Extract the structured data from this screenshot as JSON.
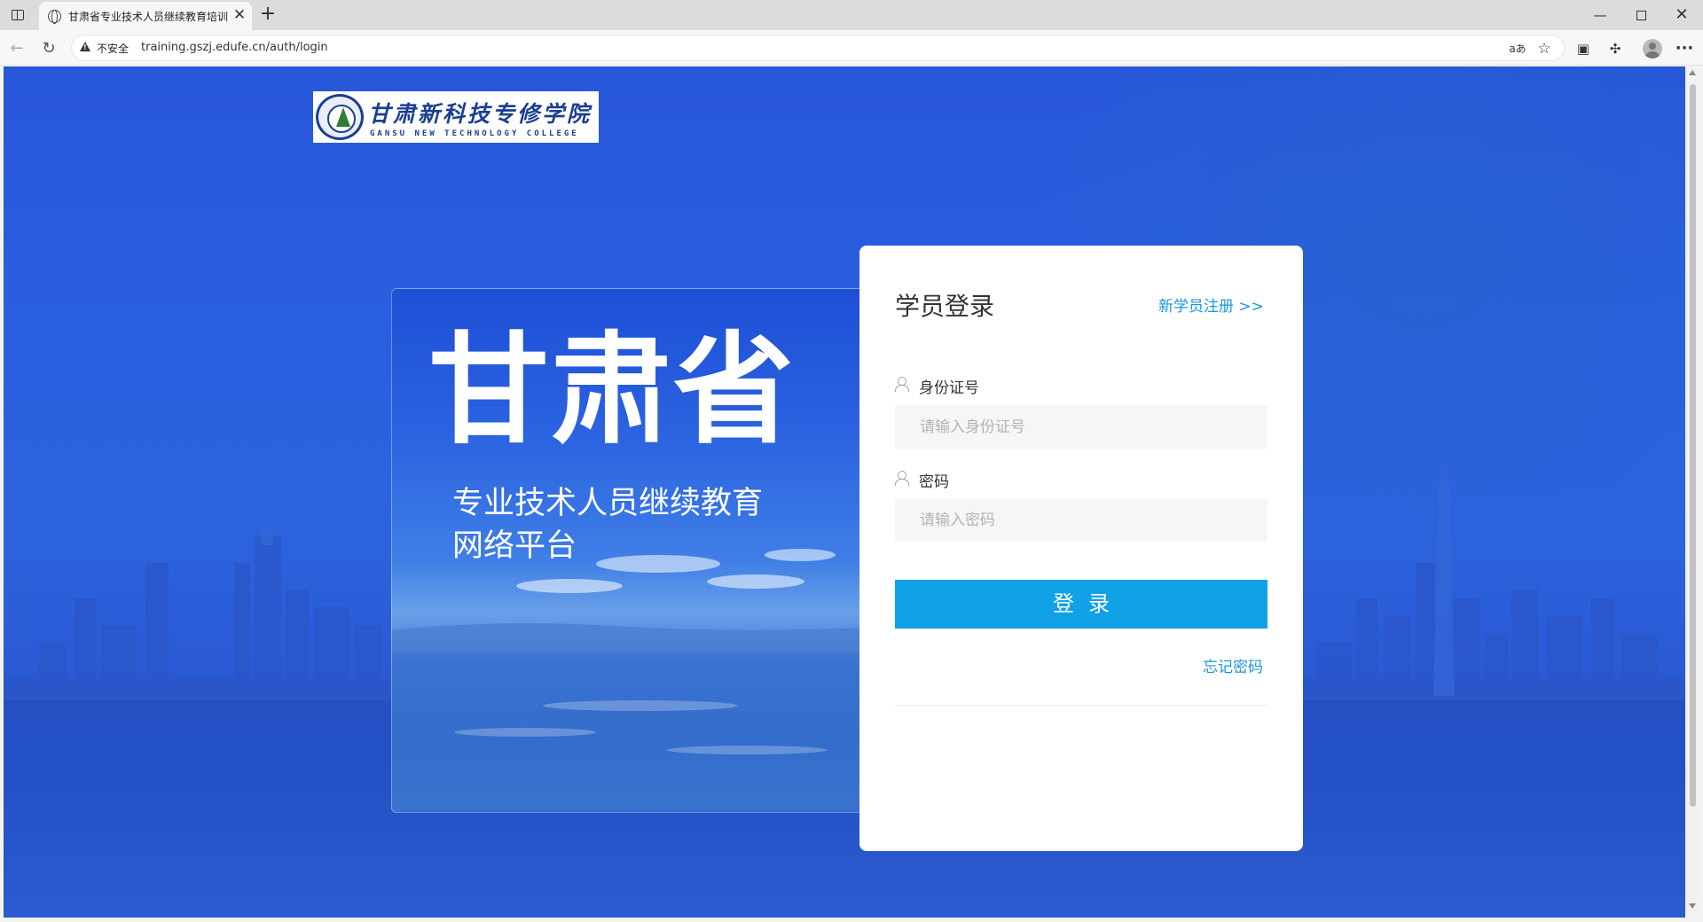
{
  "browser": {
    "tab_title": "甘肃省专业技术人员继续教育培训",
    "tab_close": "✕",
    "new_tab": "+",
    "insecure_label": "不安全",
    "url": "training.gszj.edufe.cn/auth/login",
    "translate_glyph": "aあ",
    "star_glyph": "☆",
    "more_glyph": "···",
    "minimize_glyph": "—",
    "close_glyph": "✕"
  },
  "logo": {
    "name_cn": "甘肃新科技专修学院",
    "name_en": "GANSU NEW TECHNOLOGY COLLEGE"
  },
  "banner": {
    "title": "甘肃省",
    "subtitle_line1": "专业技术人员继续教育",
    "subtitle_line2": "网络平台"
  },
  "login": {
    "heading": "学员登录",
    "register_link": "新学员注册 >>",
    "id_label": "身份证号",
    "id_placeholder": "请输入身份证号",
    "password_label": "密码",
    "password_placeholder": "请输入密码",
    "submit_label": "登录",
    "forgot_link": "忘记密码"
  },
  "colors": {
    "accent": "#10a1e6",
    "link": "#1a97dc",
    "background_blue": "#2a5fe0"
  }
}
